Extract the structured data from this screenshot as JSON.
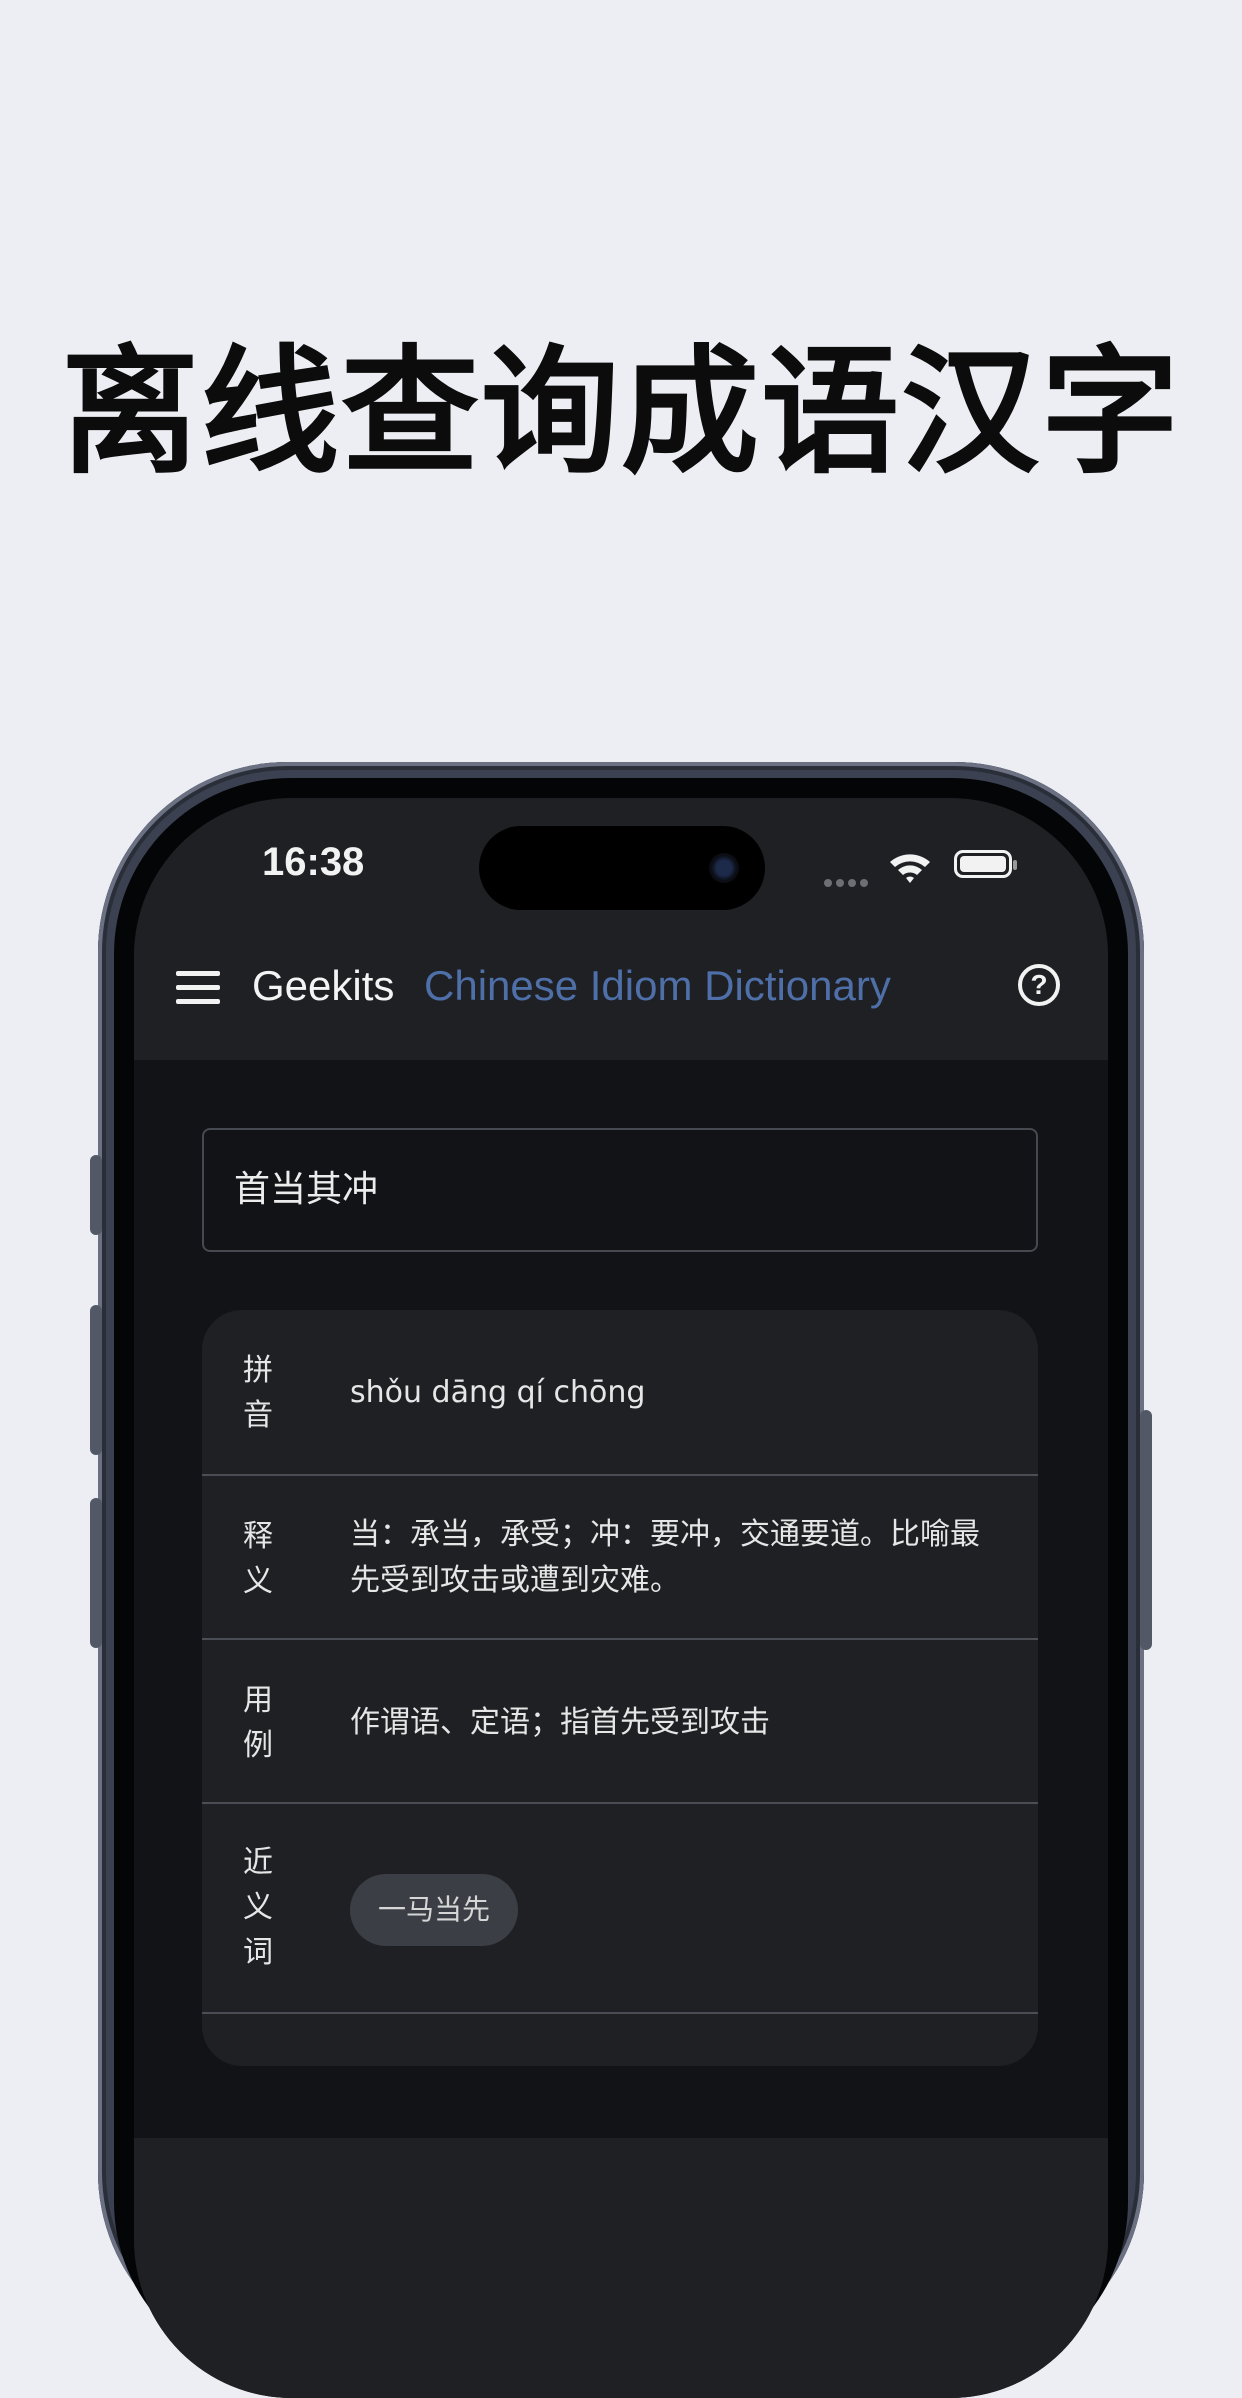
{
  "headline": "离线查询成语汉字",
  "status_bar": {
    "time": "16:38"
  },
  "app_bar": {
    "brand": "Geekits",
    "subtitle": "Chinese Idiom Dictionary"
  },
  "search": {
    "value": "首当其冲"
  },
  "entry": {
    "rows": [
      {
        "label": "拼音",
        "value": "shǒu dāng qí chōng"
      },
      {
        "label": "释义",
        "value": "当：承当，承受；冲：要冲，交通要道。比喻最先受到攻击或遭到灾难。"
      },
      {
        "label": "用例",
        "value": "作谓语、定语；指首先受到攻击"
      },
      {
        "label": "近义词",
        "chips": [
          "一马当先"
        ]
      }
    ]
  },
  "colors": {
    "page_background": "#edeef3",
    "screen_background": "#111317",
    "surface": "#1e2024",
    "accent": "#4e6fa8"
  },
  "icons": [
    "menu-icon",
    "help-icon",
    "wifi-icon",
    "battery-icon"
  ]
}
